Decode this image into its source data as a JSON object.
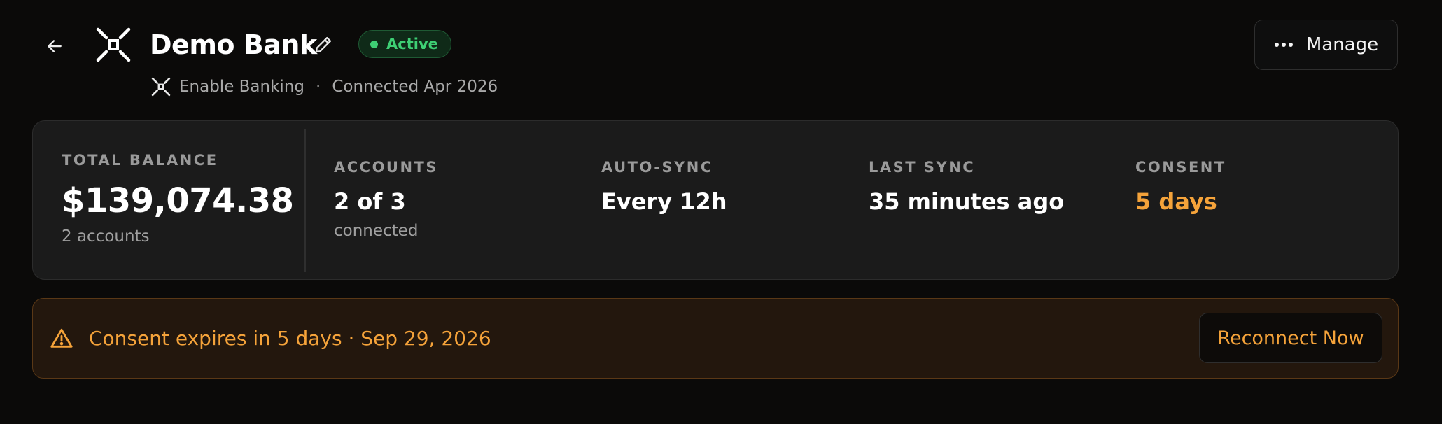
{
  "header": {
    "back_icon": "arrow-left-icon",
    "bank_logo_icon": "enable-banking-logo-icon",
    "title": "Demo Bank",
    "edit_icon": "pencil-icon",
    "status_label": "Active",
    "provider_icon": "enable-banking-logo-icon",
    "provider_name": "Enable Banking",
    "separator": "·",
    "connected_text": "Connected Apr 2026",
    "manage_icon": "more-horizontal-icon",
    "manage_label": "Manage"
  },
  "stats": {
    "total_balance": {
      "label": "TOTAL BALANCE",
      "value": "$139,074.38",
      "sub": "2 accounts"
    },
    "accounts": {
      "label": "ACCOUNTS",
      "value": "2 of 3",
      "sub": "connected"
    },
    "auto_sync": {
      "label": "AUTO-SYNC",
      "value": "Every 12h"
    },
    "last_sync": {
      "label": "LAST SYNC",
      "value": "35 minutes ago"
    },
    "consent": {
      "label": "CONSENT",
      "value": "5 days"
    }
  },
  "alert": {
    "icon": "warning-triangle-icon",
    "message": "Consent expires in 5 days · Sep 29, 2026",
    "button_label": "Reconnect Now"
  },
  "colors": {
    "background": "#0b0a09",
    "card": "#1b1b1b",
    "active_green": "#3ecf74",
    "warning_orange": "#f5a33a",
    "alert_background": "#23170d"
  }
}
